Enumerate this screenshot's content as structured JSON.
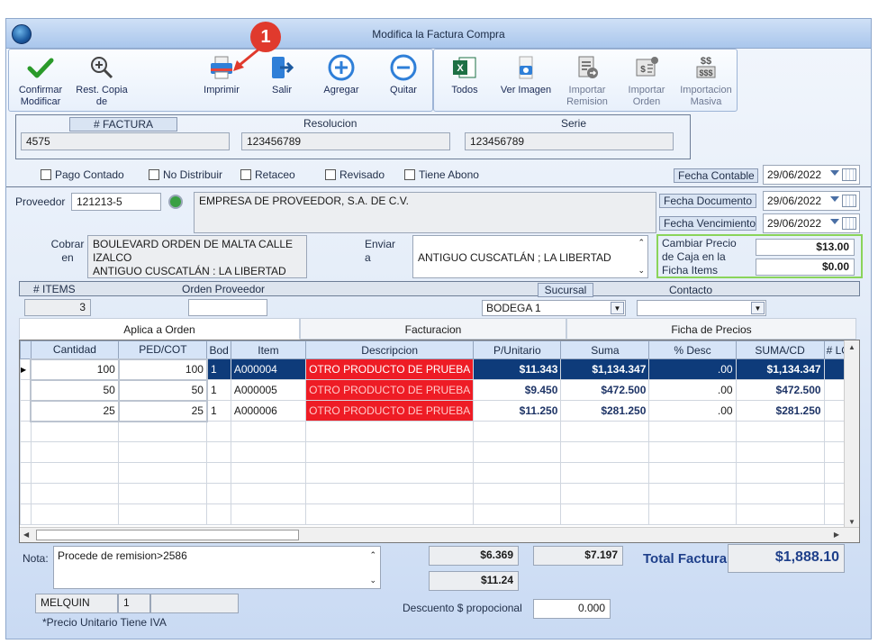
{
  "window": {
    "title": "Modifica la Factura Compra"
  },
  "annotation": {
    "number": "1"
  },
  "toolbar": {
    "confirm": "Confirmar Modificar",
    "restore": "Rest. Copia de",
    "print": "Imprimir",
    "exit": "Salir",
    "add": "Agregar",
    "remove": "Quitar",
    "all": "Todos",
    "view_image": "Ver Imagen",
    "import_remission": "Importar Remision",
    "import_order": "Importar Orden",
    "bulk_import": "Importacion Masiva"
  },
  "invoice": {
    "number_label": "# FACTURA",
    "number": "4575",
    "resolution_label": "Resolucion",
    "resolution": "123456789",
    "series_label": "Serie",
    "series": "123456789"
  },
  "checks": {
    "cash": "Pago Contado",
    "no_distribute": "No Distribuir",
    "retaceo": "Retaceo",
    "reviewed": "Revisado",
    "has_payment": "Tiene Abono"
  },
  "dates": {
    "accounting_label": "Fecha Contable",
    "accounting": "29/06/2022",
    "document_label": "Fecha Documento",
    "document": "29/06/2022",
    "due_label": "Fecha Vencimiento",
    "due": "29/06/2022"
  },
  "supplier": {
    "label": "Proveedor",
    "code": "121213-5",
    "name": "EMPRESA DE PROVEEDOR, S.A. DE C.V.",
    "collect_label": "Cobrar en",
    "collect_address": [
      "BOULEVARD ORDEN DE MALTA CALLE",
      "IZALCO",
      "ANTIGUO CUSCATLÁN : LA LIBERTAD"
    ],
    "send_label": "Enviar a",
    "send_address": "ANTIGUO CUSCATLÁN ; LA LIBERTAD"
  },
  "price_change": {
    "label": [
      "Cambiar Precio",
      "de Caja en la",
      "Ficha Items"
    ],
    "value1": "$13.00",
    "value2": "$0.00"
  },
  "order_info": {
    "items_label": "# ITEMS",
    "items": "3",
    "supplier_order_label": "Orden Proveedor",
    "supplier_order": "",
    "branch_label": "Sucursal",
    "branch": "BODEGA 1",
    "contact_label": "Contacto",
    "contact": ""
  },
  "tabs": [
    "Aplica a Orden",
    "Facturacion",
    "Ficha de Precios"
  ],
  "grid": {
    "columns": [
      "Cantidad",
      "PED/COT",
      "Bod",
      "Item",
      "Descripcion",
      "P/Unitario",
      "Suma",
      "% Desc",
      "SUMA/CD",
      "# LOT"
    ],
    "rows": [
      {
        "qty": "100",
        "ped": "100",
        "bod": "1",
        "item": "A000004",
        "desc": "OTRO PRODUCTO DE PRUEBA",
        "unit": "$11.343",
        "sum": "$1,134.347",
        "disc": ".00",
        "sumcd": "$1,134.347",
        "lot": ""
      },
      {
        "qty": "50",
        "ped": "50",
        "bod": "1",
        "item": "A000005",
        "desc": "OTRO PRODUCTO DE PRUEBA",
        "unit": "$9.450",
        "sum": "$472.500",
        "disc": ".00",
        "sumcd": "$472.500",
        "lot": ""
      },
      {
        "qty": "25",
        "ped": "25",
        "bod": "1",
        "item": "A000006",
        "desc": "OTRO PRODUCTO DE PRUEBA",
        "unit": "$11.250",
        "sum": "$281.250",
        "disc": ".00",
        "sumcd": "$281.250",
        "lot": ""
      }
    ]
  },
  "footer": {
    "note_label": "Nota:",
    "note": "Procede de remision>2586",
    "amount1": "$6.369",
    "amount2": "$7.197",
    "amount3": "$11.24",
    "total_label": "Total Factura",
    "total": "$1,888.10",
    "user": "MELQUIN",
    "user_num": "1",
    "user_extra": "",
    "discount_label": "Descuento $ propocional",
    "discount": "0.000",
    "vat_note": "*Precio Unitario Tiene IVA"
  }
}
